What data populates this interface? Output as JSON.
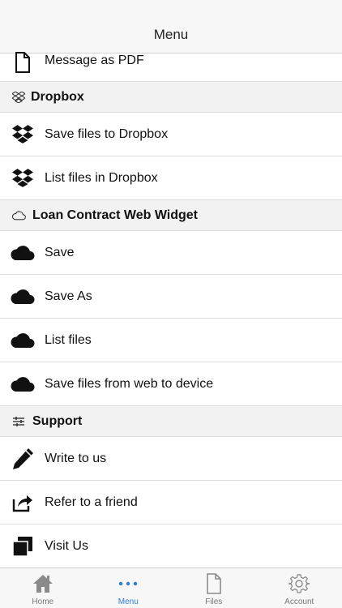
{
  "header": {
    "title": "Menu"
  },
  "items": {
    "message_pdf": "Message as PDF",
    "save_dropbox": "Save files to Dropbox",
    "list_dropbox": "List files in Dropbox",
    "save": "Save",
    "save_as": "Save As",
    "list_files": "List files",
    "save_web": "Save files from web to device",
    "write_us": "Write to us",
    "refer": "Refer to a friend",
    "visit": "Visit Us"
  },
  "sections": {
    "dropbox": "Dropbox",
    "widget": "Loan Contract Web Widget",
    "support": "Support"
  },
  "tabs": {
    "home": "Home",
    "menu": "Menu",
    "files": "Files",
    "account": "Account"
  },
  "icons": {
    "document": "document-icon",
    "dropbox": "dropbox-icon",
    "cloud": "cloud-icon",
    "sliders": "sliders-icon",
    "pencil": "pencil-icon",
    "share": "share-icon",
    "squares": "squares-icon",
    "home": "home-icon",
    "more": "more-dots-icon",
    "file": "file-icon",
    "gear": "gear-icon"
  },
  "colors": {
    "accent": "#2f7bd9",
    "section_bg": "#f2f2f2",
    "tab_inactive": "#777777"
  }
}
